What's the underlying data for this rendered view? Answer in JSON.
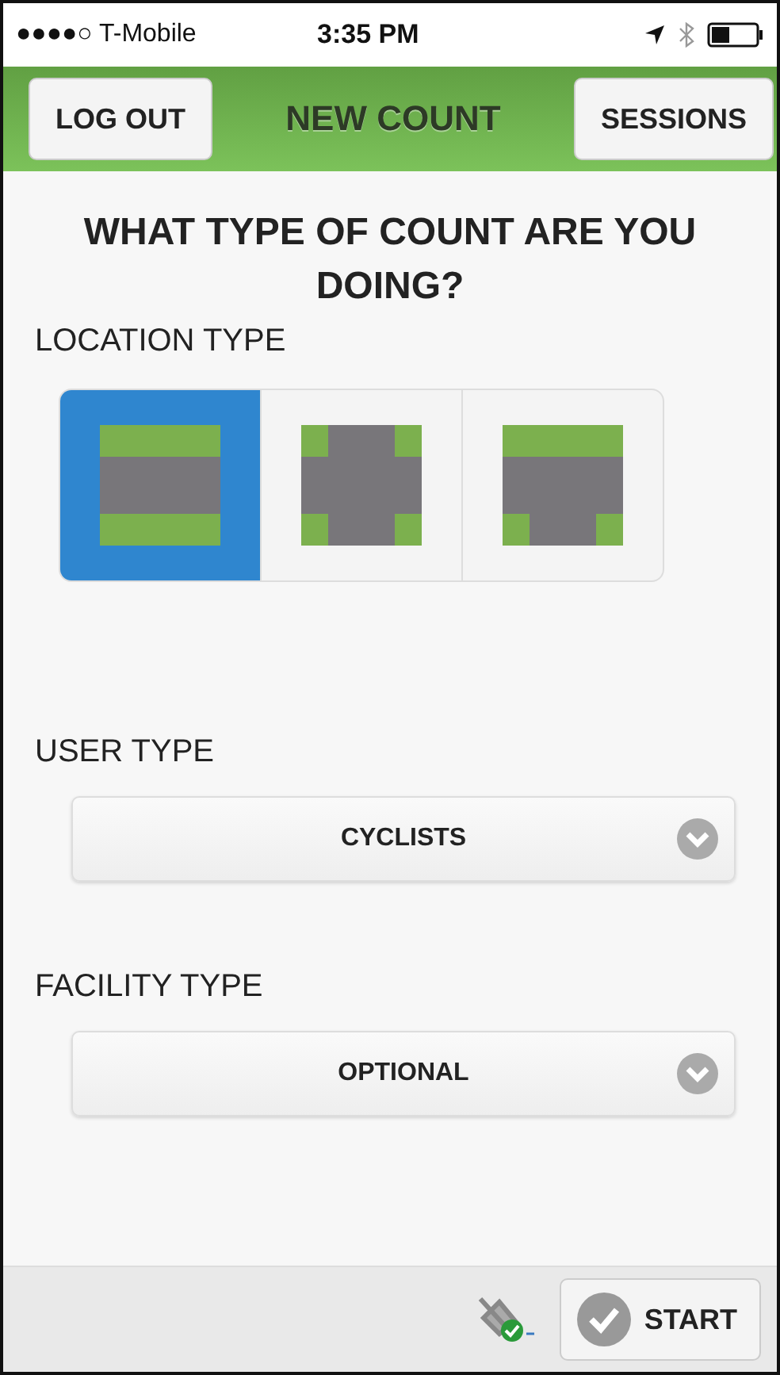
{
  "status_bar": {
    "carrier": "●●●●○ T-Mobile",
    "time": "3:35 PM"
  },
  "header": {
    "left_button": "LOG OUT",
    "title": "NEW COUNT",
    "right_button": "SESSIONS"
  },
  "heading": "WHAT TYPE OF COUNT ARE YOU DOING?",
  "location_type": {
    "label": "LOCATION TYPE",
    "options": [
      {
        "kind": "straight",
        "selected": true
      },
      {
        "kind": "intersection",
        "selected": false
      },
      {
        "kind": "t-junction",
        "selected": false
      }
    ]
  },
  "user_type": {
    "label": "USER TYPE",
    "value": "CYCLISTS"
  },
  "facility_type": {
    "label": "FACILITY TYPE",
    "value": "OPTIONAL"
  },
  "footer": {
    "start_button": "START"
  }
}
